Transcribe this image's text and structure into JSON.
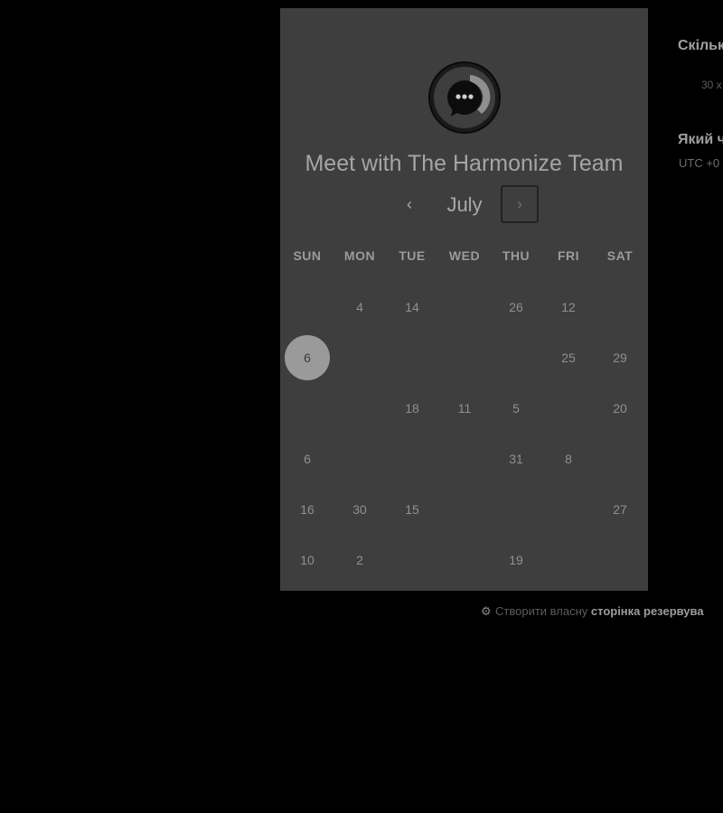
{
  "card": {
    "title": "Meet with The Harmonize Team",
    "month": "July",
    "prev_icon": "chevron-left-icon",
    "next_icon": "chevron-right-icon",
    "weekdays": [
      "SUN",
      "MON",
      "TUE",
      "WED",
      "THU",
      "FRI",
      "SAT"
    ],
    "selected_day": "6",
    "days": [
      {
        "label": "4",
        "col": 1,
        "row": 0
      },
      {
        "label": "14",
        "col": 2,
        "row": 0
      },
      {
        "label": "26",
        "col": 4,
        "row": 0
      },
      {
        "label": "12",
        "col": 5,
        "row": 0
      },
      {
        "label": "6",
        "col": 0,
        "row": 1,
        "selected": true
      },
      {
        "label": "25",
        "col": 5,
        "row": 1
      },
      {
        "label": "29",
        "col": 6,
        "row": 1
      },
      {
        "label": "18",
        "col": 2,
        "row": 2
      },
      {
        "label": "11",
        "col": 3,
        "row": 2
      },
      {
        "label": "5",
        "col": 4,
        "row": 2
      },
      {
        "label": "20",
        "col": 6,
        "row": 2
      },
      {
        "label": "6",
        "col": 0,
        "row": 3
      },
      {
        "label": "31",
        "col": 4,
        "row": 3
      },
      {
        "label": "8",
        "col": 5,
        "row": 3
      },
      {
        "label": "16",
        "col": 0,
        "row": 4
      },
      {
        "label": "30",
        "col": 1,
        "row": 4
      },
      {
        "label": "15",
        "col": 2,
        "row": 4
      },
      {
        "label": "27",
        "col": 6,
        "row": 4
      },
      {
        "label": "10",
        "col": 0,
        "row": 5
      },
      {
        "label": "2",
        "col": 1,
        "row": 5
      },
      {
        "label": "19",
        "col": 4,
        "row": 5
      }
    ]
  },
  "side": {
    "duration_question": "Скільк",
    "duration_value": "30 х",
    "timezone_question": "Який ч",
    "timezone_value": "UTC +0"
  },
  "footer": {
    "prefix": "Створити власну",
    "link": "сторінка резервува"
  },
  "colors": {
    "background": "#000000",
    "card": "#3e3e3e",
    "selected_day": "#9a9a9a"
  }
}
